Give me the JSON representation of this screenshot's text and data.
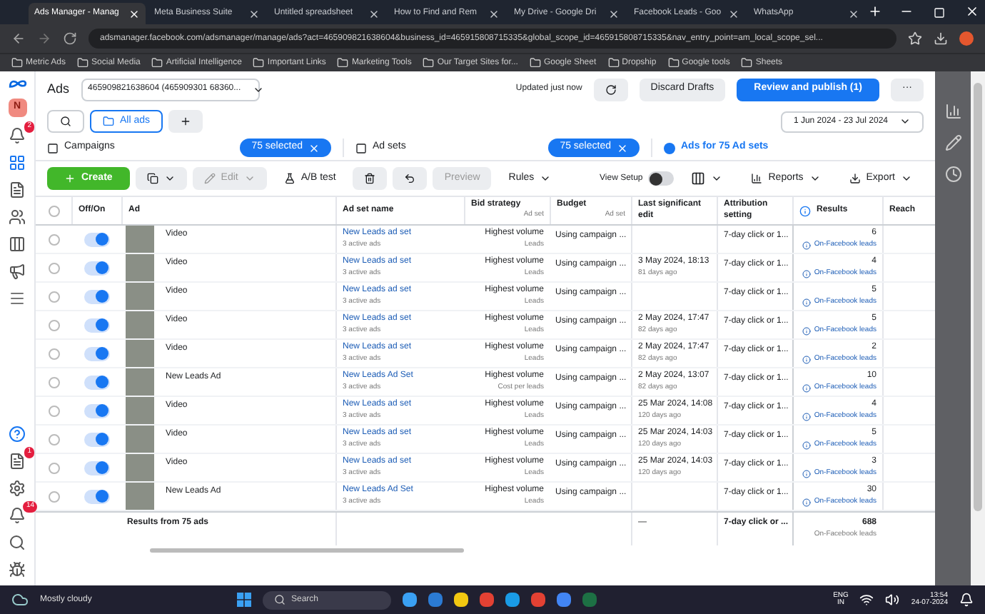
{
  "browser": {
    "tabs": [
      {
        "title": "Ads Manager - Manag",
        "selected": true
      },
      {
        "title": "Meta Business Suite",
        "selected": false
      },
      {
        "title": "Untitled spreadsheet",
        "selected": false
      },
      {
        "title": "How to Find and Rem",
        "selected": false
      },
      {
        "title": "My Drive - Google Dri",
        "selected": false
      },
      {
        "title": "Facebook Leads - Goo",
        "selected": false
      },
      {
        "title": "WhatsApp",
        "selected": false
      }
    ],
    "url": "adsmanager.facebook.com/adsmanager/manage/ads?act=465909821638604&business_id=465915808715335&global_scope_id=465915808715335&nav_entry_point=am_local_scope_sel...",
    "bookmarks": [
      "Metric Ads",
      "Social Media",
      "Artificial Intelligence",
      "Important Links",
      "Marketing Tools",
      "Our Target Sites for...",
      "Google Sheet",
      "Dropship",
      "Google tools",
      "Sheets"
    ]
  },
  "rail": {
    "avatar": "N",
    "badges": [
      "2",
      "1",
      "14"
    ]
  },
  "header": {
    "title": "Ads",
    "account": "465909821638604 (465909301 68360...",
    "status": "Updated just now",
    "discard": "Discard Drafts",
    "publish": "Review and publish (1)",
    "more": "···",
    "date_range": "1 Jun 2024 - 23 Jul 2024"
  },
  "view_tabs": [
    {
      "label": "All ads",
      "selected": true
    }
  ],
  "levels": [
    {
      "label": "Campaigns",
      "chip": "75 selected",
      "selected": false
    },
    {
      "label": "Ad sets",
      "chip": "75 selected",
      "selected": false
    },
    {
      "label": "Ads for 75 Ad sets",
      "selected": true
    }
  ],
  "toolbar": {
    "create": "Create",
    "edit": "Edit",
    "ab_test": "A/B test",
    "preview": "Preview",
    "rules": "Rules",
    "view_setup": {
      "label": "View Setup",
      "on": false
    },
    "reports": "Reports",
    "export": "Export"
  },
  "select_all": {
    "checked": false
  },
  "columns": [
    {
      "label": "Off/On"
    },
    {
      "label": "Ad"
    },
    {
      "label": "Ad set name"
    },
    {
      "label": "Bid strategy",
      "sub": "Ad set"
    },
    {
      "label": "Budget",
      "sub": "Ad set"
    },
    {
      "label": "Last significant edit"
    },
    {
      "label": "Attribution setting"
    },
    {
      "label": "Results"
    },
    {
      "label": "Reach"
    }
  ],
  "rows": [
    {
      "checked": false,
      "on": true,
      "ad": "Video",
      "ad_set": "New Leads ad set",
      "active": "3 active ads",
      "bid": "Highest volume",
      "bid_sub": "Leads",
      "budget": "Using campaign ...",
      "edit": "",
      "edit_ago": "",
      "attribution": "7-day click or 1...",
      "results": "6",
      "results_sub": "On-Facebook leads"
    },
    {
      "checked": false,
      "on": true,
      "ad": "Video",
      "ad_set": "New Leads ad set",
      "active": "3 active ads",
      "bid": "Highest volume",
      "bid_sub": "Leads",
      "budget": "Using campaign ...",
      "edit": "3 May 2024, 18:13",
      "edit_ago": "81 days ago",
      "attribution": "7-day click or 1...",
      "results": "4",
      "results_sub": "On-Facebook leads"
    },
    {
      "checked": false,
      "on": true,
      "ad": "Video",
      "ad_set": "New Leads ad set",
      "active": "3 active ads",
      "bid": "Highest volume",
      "bid_sub": "Leads",
      "budget": "Using campaign ...",
      "edit": "",
      "edit_ago": "",
      "attribution": "7-day click or 1...",
      "results": "5",
      "results_sub": "On-Facebook leads"
    },
    {
      "checked": false,
      "on": true,
      "ad": "Video",
      "ad_set": "New Leads ad set",
      "active": "3 active ads",
      "bid": "Highest volume",
      "bid_sub": "Leads",
      "budget": "Using campaign ...",
      "edit": "2 May 2024, 17:47",
      "edit_ago": "82 days ago",
      "attribution": "7-day click or 1...",
      "results": "5",
      "results_sub": "On-Facebook leads"
    },
    {
      "checked": false,
      "on": true,
      "ad": "Video",
      "ad_set": "New Leads ad set",
      "active": "3 active ads",
      "bid": "Highest volume",
      "bid_sub": "Leads",
      "budget": "Using campaign ...",
      "edit": "2 May 2024, 17:47",
      "edit_ago": "82 days ago",
      "attribution": "7-day click or 1...",
      "results": "2",
      "results_sub": "On-Facebook leads"
    },
    {
      "checked": false,
      "on": true,
      "ad": "New Leads Ad",
      "ad_set": "New Leads Ad Set",
      "active": "3 active ads",
      "bid": "Highest volume",
      "bid_sub": "Cost per leads",
      "budget": "Using campaign ...",
      "edit": "2 May 2024, 13:07",
      "edit_ago": "82 days ago",
      "attribution": "7-day click or 1...",
      "results": "10",
      "results_sub": "On-Facebook leads"
    },
    {
      "checked": false,
      "on": true,
      "ad": "Video",
      "ad_set": "New Leads ad set",
      "active": "3 active ads",
      "bid": "Highest volume",
      "bid_sub": "Leads",
      "budget": "Using campaign ...",
      "edit": "25 Mar 2024, 14:08",
      "edit_ago": "120 days ago",
      "attribution": "7-day click or 1...",
      "results": "4",
      "results_sub": "On-Facebook leads"
    },
    {
      "checked": false,
      "on": true,
      "ad": "Video",
      "ad_set": "New Leads ad set",
      "active": "3 active ads",
      "bid": "Highest volume",
      "bid_sub": "Leads",
      "budget": "Using campaign ...",
      "edit": "25 Mar 2024, 14:03",
      "edit_ago": "120 days ago",
      "attribution": "7-day click or 1...",
      "results": "5",
      "results_sub": "On-Facebook leads"
    },
    {
      "checked": false,
      "on": true,
      "ad": "Video",
      "ad_set": "New Leads ad set",
      "active": "3 active ads",
      "bid": "Highest volume",
      "bid_sub": "Leads",
      "budget": "Using campaign ...",
      "edit": "25 Mar 2024, 14:03",
      "edit_ago": "120 days ago",
      "attribution": "7-day click or 1...",
      "results": "3",
      "results_sub": "On-Facebook leads"
    },
    {
      "checked": false,
      "on": true,
      "ad": "New Leads Ad",
      "ad_set": "New Leads Ad Set",
      "active": "3 active ads",
      "bid": "Highest volume",
      "bid_sub": "Leads",
      "budget": "Using campaign ...",
      "edit": "",
      "edit_ago": "",
      "attribution": "7-day click or 1...",
      "results": "30",
      "results_sub": "On-Facebook leads"
    }
  ],
  "footer": {
    "label": "Results from 75 ads",
    "edit": "—",
    "attribution": "7-day click or ...",
    "results": "688",
    "results_sub": "On-Facebook leads"
  },
  "taskbar": {
    "weather": "Mostly cloudy",
    "search": "Search",
    "lang": "ENG",
    "region": "IN",
    "time": "13:54",
    "date": "24-07-2024"
  }
}
